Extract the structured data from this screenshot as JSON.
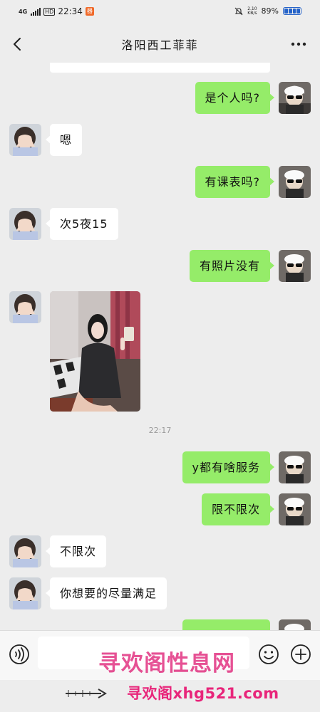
{
  "status_bar": {
    "network": "4G",
    "hd": "HD",
    "time": "22:34",
    "app_badge": "器",
    "net_speed_top": "2.10",
    "net_speed_bottom": "KB/s",
    "battery": "89%"
  },
  "header": {
    "title": "洛阳西工菲菲"
  },
  "messages": [
    {
      "from": "me",
      "text": "是个人吗?"
    },
    {
      "from": "other",
      "text": "嗯"
    },
    {
      "from": "me",
      "text": "有课表吗?"
    },
    {
      "from": "other",
      "text": "次5夜15"
    },
    {
      "from": "me",
      "text": "有照片没有"
    },
    {
      "from": "other",
      "type": "image"
    },
    {
      "from": "me",
      "text": "y都有啥服务"
    },
    {
      "from": "me",
      "text": "限不限次"
    },
    {
      "from": "other",
      "text": "不限次"
    },
    {
      "from": "other",
      "text": "你想要的尽量满足"
    },
    {
      "from": "me",
      "text": ""
    }
  ],
  "timestamp": "22:17",
  "input": {
    "placeholder": ""
  },
  "watermark": {
    "center_text": "寻欢阁性息网",
    "url_text": "寻欢阁xhg521.com"
  },
  "icons": {
    "back": "back-arrow-icon",
    "more": "more-dots-icon",
    "voice": "voice-icon",
    "emoji": "emoji-icon",
    "plus": "plus-icon"
  },
  "colors": {
    "my_bubble": "#95ec69",
    "their_bubble": "#ffffff",
    "background": "#ededed",
    "watermark": "#e8257a"
  }
}
